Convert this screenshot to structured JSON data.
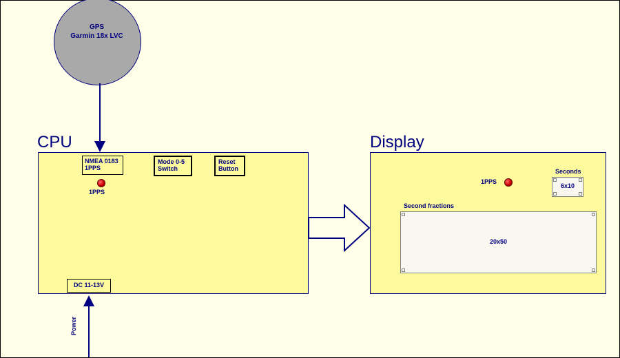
{
  "gps": {
    "line1": "GPS",
    "line2": "Garmin 18x LVC"
  },
  "cpu": {
    "title": "CPU",
    "nmea": {
      "line1": "NMEA 0183",
      "line2": "1PPS"
    },
    "mode": {
      "line1": "Mode 0-5",
      "line2": "Switch"
    },
    "reset": {
      "line1": "Reset",
      "line2": "Button"
    },
    "led_label": "1PPS",
    "power_port": "DC 11-13V",
    "power_label": "Power"
  },
  "display": {
    "title": "Display",
    "led_label": "1PPS",
    "seconds": {
      "label": "Seconds",
      "dims": "6x10"
    },
    "fractions": {
      "label": "Second fractions",
      "dims": "20x50"
    }
  }
}
